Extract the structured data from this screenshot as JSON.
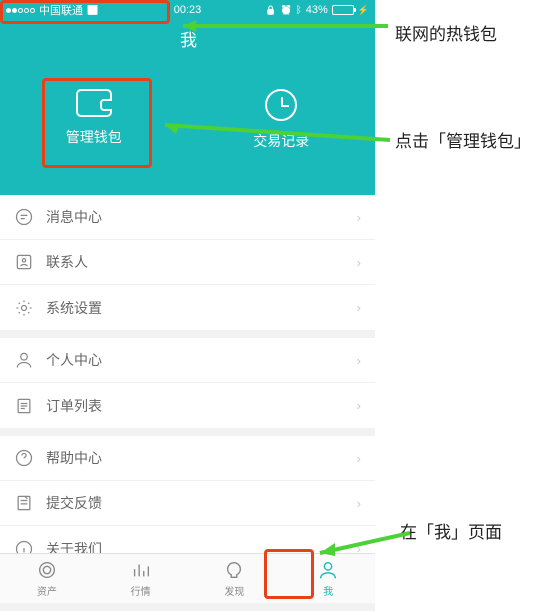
{
  "status": {
    "carrier": "中国联通",
    "time": "00:23",
    "battery": "43%"
  },
  "header": {
    "title": "我",
    "actions": {
      "wallet": "管理钱包",
      "history": "交易记录"
    }
  },
  "menu": {
    "group1": [
      {
        "id": "messages",
        "label": "消息中心"
      },
      {
        "id": "contacts",
        "label": "联系人"
      },
      {
        "id": "settings",
        "label": "系统设置"
      }
    ],
    "group2": [
      {
        "id": "profile",
        "label": "个人中心"
      },
      {
        "id": "orders",
        "label": "订单列表"
      }
    ],
    "group3": [
      {
        "id": "help",
        "label": "帮助中心"
      },
      {
        "id": "feedback",
        "label": "提交反馈"
      },
      {
        "id": "about",
        "label": "关于我们"
      }
    ]
  },
  "tabs": {
    "assets": "资产",
    "market": "行情",
    "discover": "发现",
    "me": "我"
  },
  "annotations": {
    "hot_wallet": "联网的热钱包",
    "click_wallet": "点击「管理钱包」",
    "me_page": "在「我」页面"
  }
}
